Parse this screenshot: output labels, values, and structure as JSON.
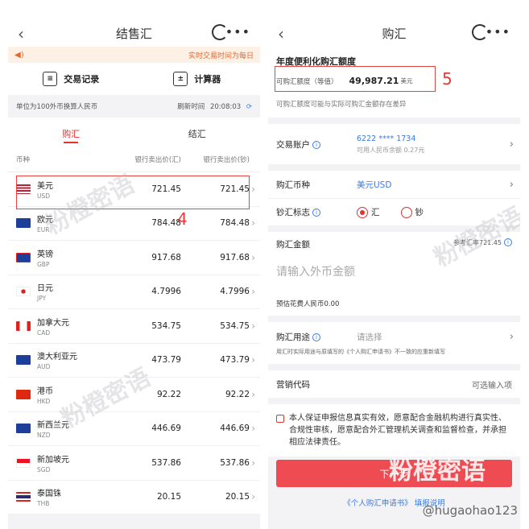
{
  "left": {
    "title": "结售汇",
    "notice": "实时交易时间为每日",
    "tools": [
      {
        "label": "交易记录",
        "icon": "≡"
      },
      {
        "label": "计算器",
        "icon": "±"
      }
    ],
    "unit_text": "单位为100外币换算人民币",
    "refresh_label": "刷新时间",
    "refresh_time": "20:08:03",
    "tabs": [
      "购汇",
      "结汇"
    ],
    "columns": [
      "币种",
      "银行卖出价(汇)",
      "银行卖出价(钞)"
    ],
    "rows": [
      {
        "zh": "美元",
        "code": "USD",
        "v1": "721.45",
        "v2": "721.45",
        "flag": "us"
      },
      {
        "zh": "欧元",
        "code": "EUR",
        "v1": "784.48",
        "v2": "784.48",
        "flag": "eu"
      },
      {
        "zh": "英镑",
        "code": "GBP",
        "v1": "917.68",
        "v2": "917.68",
        "flag": "gb"
      },
      {
        "zh": "日元",
        "code": "JPY",
        "v1": "4.7996",
        "v2": "4.7996",
        "flag": "jp"
      },
      {
        "zh": "加拿大元",
        "code": "CAD",
        "v1": "534.75",
        "v2": "534.75",
        "flag": "ca"
      },
      {
        "zh": "澳大利亚元",
        "code": "AUD",
        "v1": "473.79",
        "v2": "473.79",
        "flag": "au"
      },
      {
        "zh": "港币",
        "code": "HKD",
        "v1": "92.22",
        "v2": "92.22",
        "flag": "hk"
      },
      {
        "zh": "新西兰元",
        "code": "NZD",
        "v1": "446.69",
        "v2": "446.69",
        "flag": "nz"
      },
      {
        "zh": "新加坡元",
        "code": "SGD",
        "v1": "537.86",
        "v2": "537.86",
        "flag": "sg"
      },
      {
        "zh": "泰国铢",
        "code": "THB",
        "v1": "20.15",
        "v2": "20.15",
        "flag": "th"
      }
    ],
    "annotation": "4"
  },
  "right": {
    "title": "购汇",
    "quota_title": "年度便利化购汇额度",
    "quota_label": "可购汇额度（等值）",
    "quota_amount": "49,987.21",
    "quota_currency": "美元",
    "quota_note": "可购汇额度可能与实际可购汇金额存在差异",
    "annotation": "5",
    "account_label": "交易账户",
    "account_number": "6222 **** 1734",
    "account_balance": "可用人民币余额 0.27元",
    "currency_label": "购汇币种",
    "currency_value": "美元USD",
    "cash_label": "钞汇标志",
    "cash_options": [
      "汇",
      "钞"
    ],
    "amount_label": "购汇金额",
    "ref_rate": "参考汇率721.45",
    "amount_placeholder": "请输入外币金额",
    "estimate": "预估花费人民币0.00",
    "purpose_label": "购汇用途",
    "purpose_placeholder": "请选择",
    "purpose_note": "用汇时实际用途与原填写的《个人购汇申请书》不一致的应重新填写",
    "marketing_label": "营销代码",
    "marketing_placeholder": "可选输入项",
    "agreement": "本人保证申报信息真实有效，愿意配合金融机构进行真实性、合规性审核，愿意配合外汇管理机关调查和监督检查，并承担相应法律责任。",
    "next_button": "下一步",
    "link1": "《个人购汇申请书》",
    "link2": "填报说明"
  },
  "watermark": "粉橙密语",
  "weibo_handle": "@hugaohao123",
  "colors": {
    "accent": "#e0332e",
    "link": "#3b7be0",
    "button": "#ef4b52",
    "annotation": "#e83a3a"
  }
}
